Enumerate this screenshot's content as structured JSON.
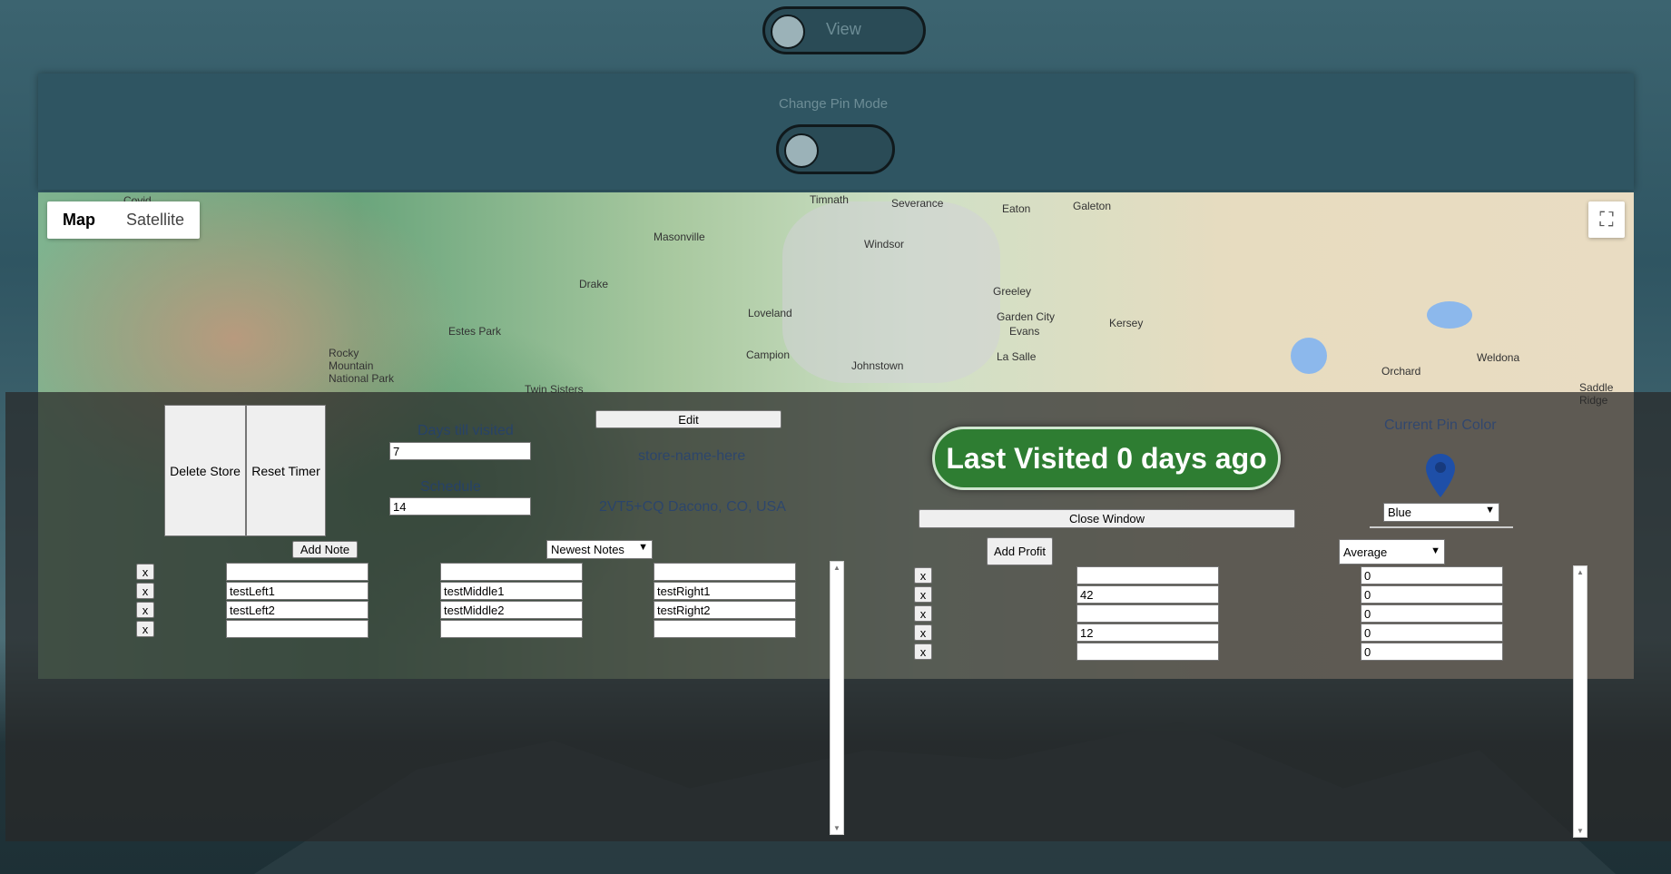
{
  "view_toggle": {
    "label": "View"
  },
  "pin_mode": {
    "label": "Change Pin Mode"
  },
  "map": {
    "type_options": [
      "Map",
      "Satellite"
    ],
    "places": [
      "Severance",
      "Timnath",
      "Eaton",
      "Galeton",
      "Masonville",
      "Windsor",
      "Drake",
      "Greeley",
      "Loveland",
      "Estes Park",
      "Garden City",
      "Kersey",
      "Evans",
      "Campion",
      "La Salle",
      "Johnstown",
      "Rocky Mountain National Park",
      "Orchard",
      "Weldona",
      "Saddle Ridge",
      "Twin Sisters",
      "Covid"
    ]
  },
  "store": {
    "delete_label": "Delete Store",
    "reset_label": "Reset Timer",
    "field_a_label": "Days till visited",
    "field_a_value": "7",
    "field_b_label": "Schedule",
    "field_b_value": "14",
    "edit_label": "Edit",
    "name_placeholder": "store-name-here",
    "address": "2VT5+CQ Dacono, CO, USA"
  },
  "notes": {
    "add_label": "Add Note",
    "sort_selected": "Newest Notes",
    "remove_label": "x",
    "rows": [
      {
        "left": "",
        "middle": "",
        "right": ""
      },
      {
        "left": "testLeft1",
        "middle": "testMiddle1",
        "right": "testRight1"
      },
      {
        "left": "testLeft2",
        "middle": "testMiddle2",
        "right": "testRight2"
      },
      {
        "left": "",
        "middle": "",
        "right": ""
      }
    ]
  },
  "visit": {
    "status": "Last Visited 0 days ago",
    "close_label": "Close Window"
  },
  "pin_color": {
    "label": "Current Pin Color",
    "selected": "Blue",
    "color": "#1e4fa8"
  },
  "profit": {
    "add_label": "Add Profit",
    "mode_selected": "Average",
    "remove_label": "x",
    "rows": [
      {
        "amount": "",
        "value": "0"
      },
      {
        "amount": "42",
        "value": "0"
      },
      {
        "amount": "",
        "value": "0"
      },
      {
        "amount": "12",
        "value": "0"
      },
      {
        "amount": "",
        "value": "0"
      }
    ]
  },
  "colors": {
    "visited_green": "#2e7d32",
    "panel_teal": "#2f5562",
    "pin_blue": "#1e4fa8"
  }
}
